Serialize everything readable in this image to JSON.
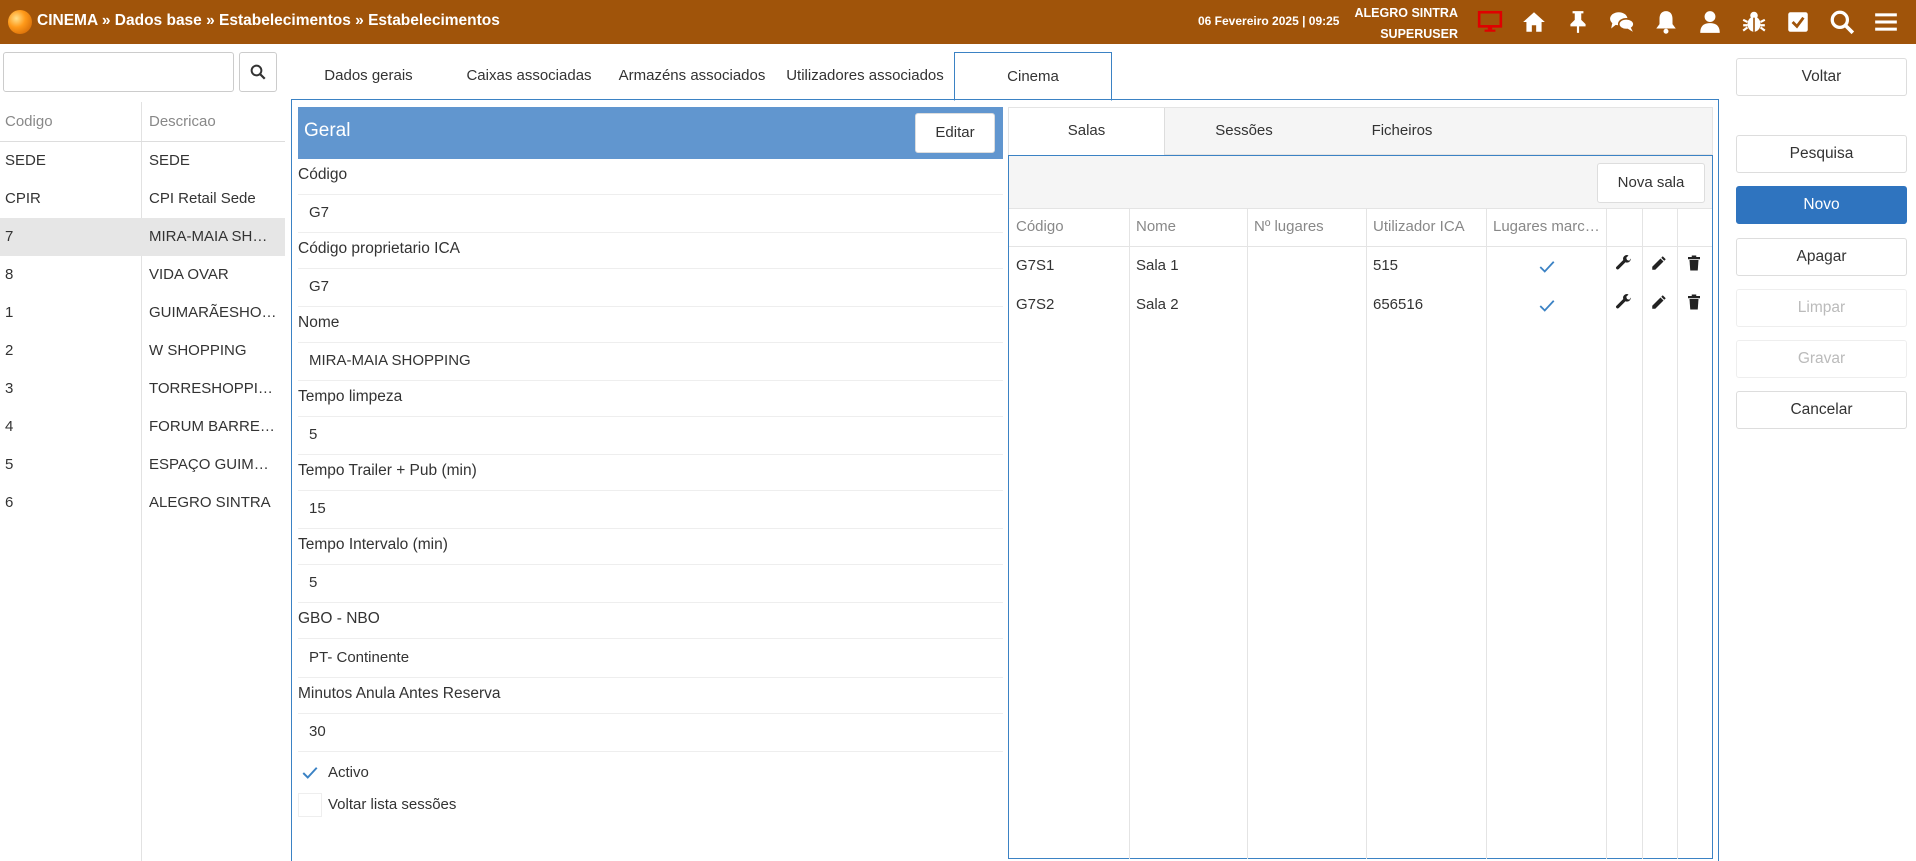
{
  "topbar": {
    "breadcrumb": "CINEMA » Dados base » Estabelecimentos » Estabelecimentos",
    "datetime": "06 Fevereiro 2025 | 09:25",
    "store": "ALEGRO SINTRA",
    "user": "SUPERUSER",
    "icons": [
      "monitor-icon",
      "home-icon",
      "pin-icon",
      "chat-icon",
      "bell-icon",
      "user-icon",
      "bug-icon",
      "checkbox-icon",
      "search-icon",
      "menu-icon"
    ],
    "monitor_color": "#e00000"
  },
  "left": {
    "search_value": "",
    "headers": {
      "code": "Codigo",
      "desc": "Descricao"
    },
    "rows": [
      {
        "code": "SEDE",
        "desc": "SEDE"
      },
      {
        "code": "CPIR",
        "desc": "CPI Retail Sede"
      },
      {
        "code": "7",
        "desc": "MIRA-MAIA SHOPPING"
      },
      {
        "code": "8",
        "desc": "VIDA OVAR"
      },
      {
        "code": "1",
        "desc": "GUIMARÃESHOPPING"
      },
      {
        "code": "2",
        "desc": "W SHOPPING"
      },
      {
        "code": "3",
        "desc": "TORRESHOPPING"
      },
      {
        "code": "4",
        "desc": "FORUM BARREIRO"
      },
      {
        "code": "5",
        "desc": "ESPAÇO GUIMARÃES"
      },
      {
        "code": "6",
        "desc": "ALEGRO SINTRA"
      }
    ],
    "selected_index": 2
  },
  "tabs": [
    "Dados gerais",
    "Caixas associadas",
    "Armazéns associados",
    "Utilizadores associados",
    "Cinema"
  ],
  "active_tab": "Cinema",
  "geral": {
    "title": "Geral",
    "edit_label": "Editar",
    "fields": [
      {
        "label": "Código",
        "value": "G7"
      },
      {
        "label": "Código proprietario ICA",
        "value": "G7"
      },
      {
        "label": "Nome",
        "value": "MIRA-MAIA SHOPPING"
      },
      {
        "label": "Tempo limpeza",
        "value": "5"
      },
      {
        "label": "Tempo Trailer + Pub (min)",
        "value": "15"
      },
      {
        "label": "Tempo Intervalo (min)",
        "value": "5"
      },
      {
        "label": "GBO - NBO",
        "value": "PT- Continente"
      },
      {
        "label": "Minutos Anula Antes Reserva",
        "value": "30"
      }
    ],
    "checkboxes": [
      {
        "label": "Activo",
        "checked": true
      },
      {
        "label": "Voltar lista sessões",
        "checked": false
      }
    ]
  },
  "subtabs": [
    "Salas",
    "Sessões",
    "Ficheiros"
  ],
  "active_subtab": "Salas",
  "salas": {
    "new_label": "Nova sala",
    "headers": [
      "Código",
      "Nome",
      "Nº lugares",
      "Utilizador ICA",
      "Lugares marcados"
    ],
    "rows": [
      {
        "code": "G7S1",
        "name": "Sala 1",
        "seats": "",
        "ica": "515",
        "marked": true
      },
      {
        "code": "G7S2",
        "name": "Sala 2",
        "seats": "",
        "ica": "656516",
        "marked": true
      }
    ]
  },
  "actions": [
    {
      "label": "Voltar",
      "state": "normal"
    },
    {
      "label": "Pesquisa",
      "state": "normal"
    },
    {
      "label": "Novo",
      "state": "primary"
    },
    {
      "label": "Apagar",
      "state": "normal"
    },
    {
      "label": "Limpar",
      "state": "disabled"
    },
    {
      "label": "Gravar",
      "state": "disabled"
    },
    {
      "label": "Cancelar",
      "state": "normal"
    }
  ],
  "accent_color": "#3b82c4",
  "header_color": "#a0540a"
}
